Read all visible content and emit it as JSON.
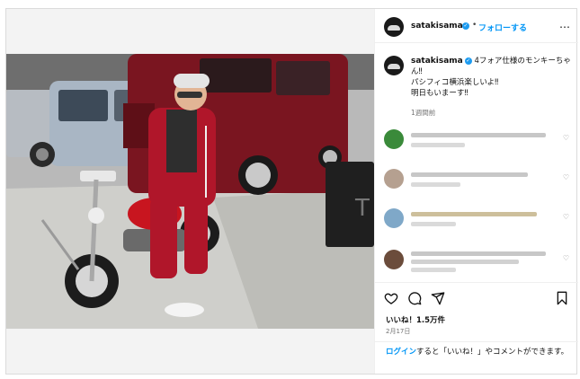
{
  "header": {
    "username": "satakisama",
    "separator": "•",
    "follow_label": "フォローする",
    "more_icon": "…"
  },
  "caption": {
    "username": "satakisama",
    "line1": "4フォア仕様のモンキーちゃん‼",
    "line2": "パシフィコ横浜楽しいよ‼",
    "line3": "明日もいまーす‼",
    "timestamp": "1週間前"
  },
  "actions": {
    "like_icon": "heart-icon",
    "comment_icon": "comment-icon",
    "share_icon": "share-icon",
    "save_icon": "bookmark-icon"
  },
  "stats": {
    "likes": "いいね！1.5万件",
    "date": "2月17日"
  },
  "login_prompt": {
    "login_link": "ログイン",
    "rest": "すると「いいね！」やコメントができます。"
  },
  "colors": {
    "accent": "#0095f6",
    "verified": "#1d9bf0",
    "van": "#7a1520",
    "jacket": "#b0162a"
  }
}
